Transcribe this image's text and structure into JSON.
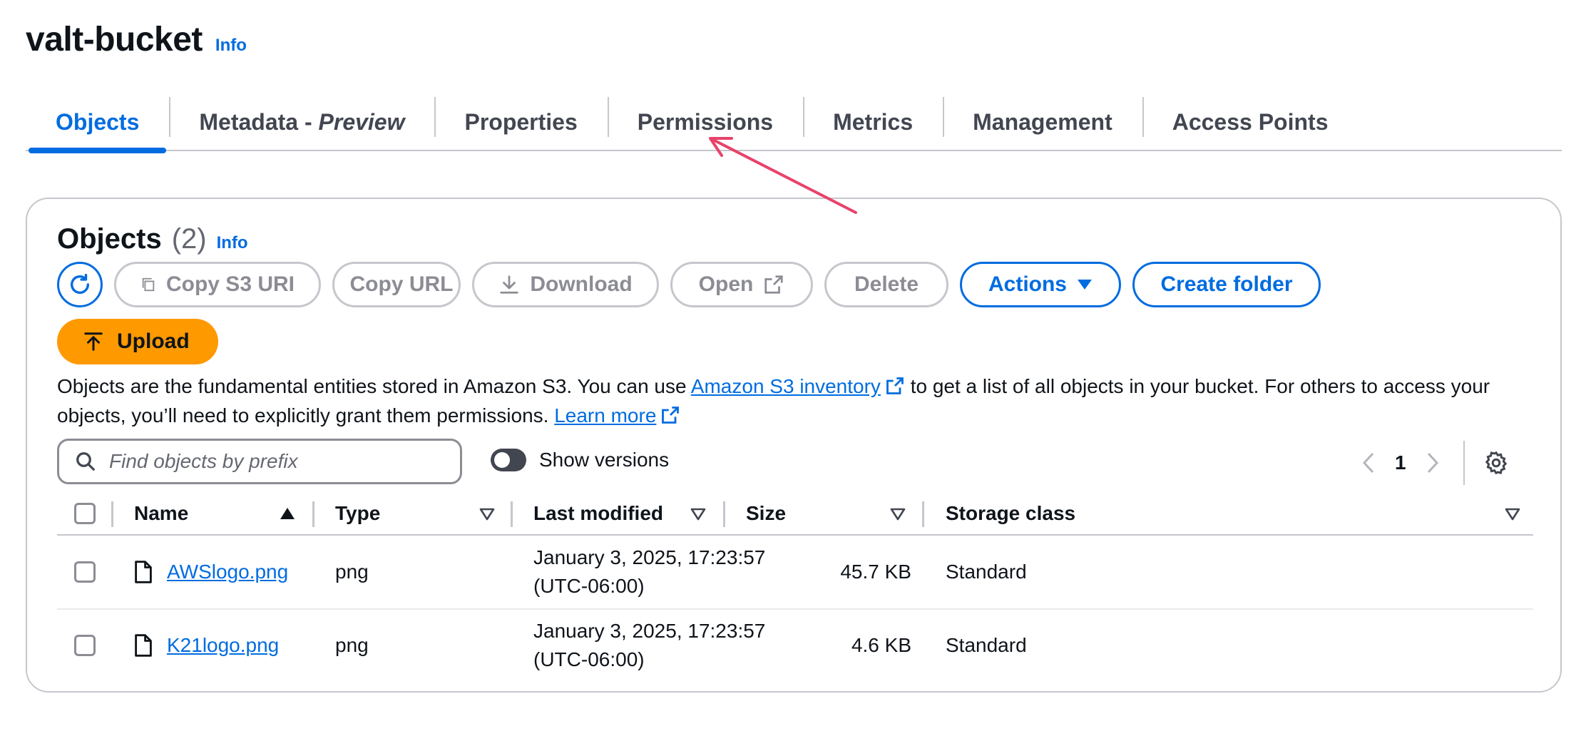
{
  "bucket": {
    "name": "valt-bucket",
    "info": "Info"
  },
  "tabs": [
    {
      "label": "Objects",
      "active": true
    },
    {
      "label_main": "Metadata - ",
      "label_em": "Preview"
    },
    {
      "label": "Properties"
    },
    {
      "label": "Permissions"
    },
    {
      "label": "Metrics"
    },
    {
      "label": "Management"
    },
    {
      "label": "Access Points"
    }
  ],
  "objects_panel": {
    "title": "Objects",
    "count": "(2)",
    "info": "Info",
    "toolbar": {
      "refresh_icon": "refresh-icon",
      "copy_s3_uri": "Copy S3 URI",
      "copy_url": "Copy URL",
      "download": "Download",
      "open": "Open",
      "delete": "Delete",
      "actions": "Actions",
      "create_folder": "Create folder",
      "upload": "Upload"
    },
    "description": {
      "part1": "Objects are the fundamental entities stored in Amazon S3. You can use ",
      "link1": "Amazon S3 inventory",
      "part2": " to get a list of all objects in your bucket. For others to access your objects, you’ll need to explicitly grant them permissions. ",
      "link2": "Learn more"
    },
    "search": {
      "placeholder": "Find objects by prefix"
    },
    "show_versions": {
      "label": "Show versions",
      "enabled": false
    },
    "pagination": {
      "current_page": "1"
    },
    "table": {
      "columns": [
        "Name",
        "Type",
        "Last modified",
        "Size",
        "Storage class"
      ],
      "rows": [
        {
          "name": "AWSlogo.png",
          "type": "png",
          "modified_line1": "January 3, 2025, 17:23:57",
          "modified_line2": "(UTC-06:00)",
          "size": "45.7 KB",
          "storage_class": "Standard"
        },
        {
          "name": "K21logo.png",
          "type": "png",
          "modified_line1": "January 3, 2025, 17:23:57",
          "modified_line2": "(UTC-06:00)",
          "size": "4.6 KB",
          "storage_class": "Standard"
        }
      ]
    }
  },
  "colors": {
    "accent": "#006ce0",
    "upload": "#ff9900",
    "annotation_arrow": "#e8436a",
    "border": "#c6c6cd"
  }
}
